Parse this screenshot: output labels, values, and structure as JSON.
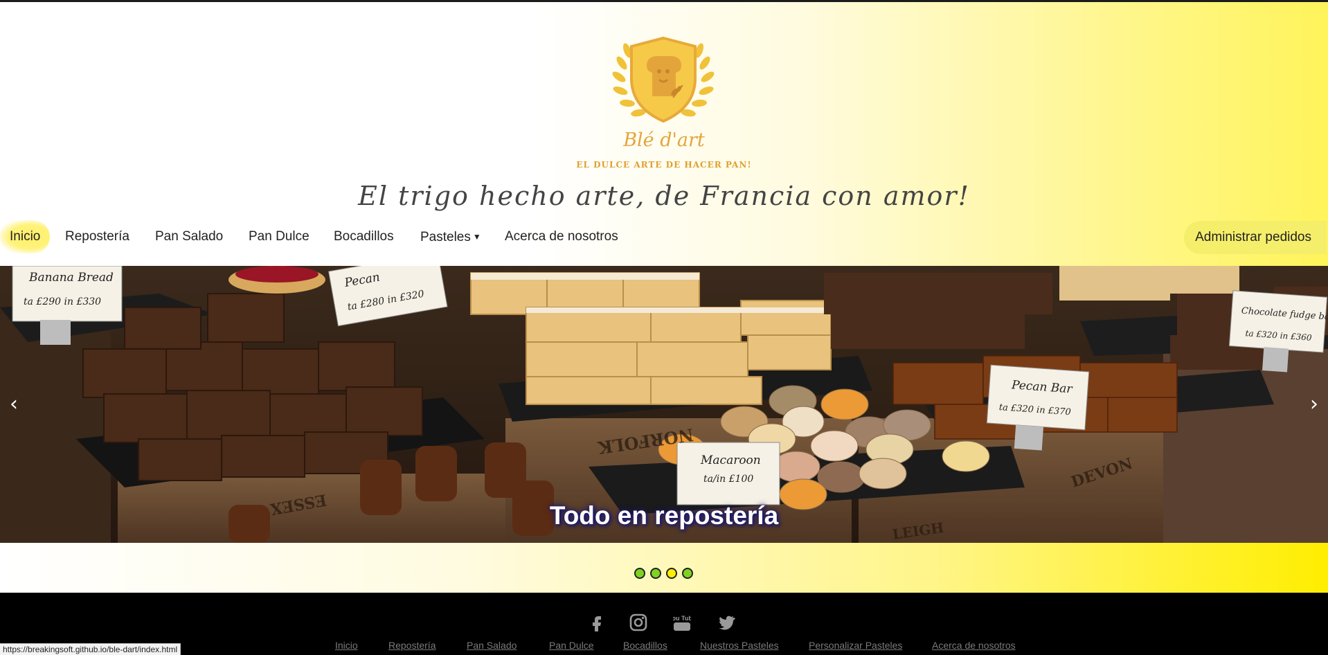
{
  "brand": {
    "name": "Blé d'art",
    "subtitle": "EL DULCE ARTE DE HACER PAN!",
    "tagline": "El trigo hecho arte, de Francia con amor!",
    "colors": {
      "gold": "#e3a53b",
      "yellow": "#fff45a",
      "shield": "#f7c948"
    }
  },
  "nav": {
    "items": [
      {
        "label": "Inicio",
        "active": true
      },
      {
        "label": "Repostería"
      },
      {
        "label": "Pan Salado"
      },
      {
        "label": "Pan Dulce"
      },
      {
        "label": "Bocadillos"
      },
      {
        "label": "Pasteles",
        "dropdown": true
      },
      {
        "label": "Acerca de nosotros"
      }
    ],
    "admin_button": "Administrar pedidos"
  },
  "carousel": {
    "caption": "Todo en repostería",
    "prev_icon": "chevron-left-icon",
    "next_icon": "chevron-right-icon",
    "prev_glyph": "‹",
    "next_glyph": "›",
    "price_tags": [
      {
        "title": "Banana Bread",
        "prices": "ta £290   in £330"
      },
      {
        "title": "Pecan",
        "prices": "ta £280   in £320"
      },
      {
        "title": "Macaroon",
        "prices": "ta/in £100"
      },
      {
        "title": "Pecan Bar",
        "prices": "ta £320   in £370"
      },
      {
        "title": "Chocolate fudge bar",
        "prices": "ta £320   in £360"
      }
    ],
    "crate_labels": [
      "NORFOLK",
      "ESSEX",
      "DEVON",
      "LEIGH"
    ],
    "indicators": [
      {
        "active": true,
        "color": "#7ed321"
      },
      {
        "active": false,
        "color": "#7ed321"
      },
      {
        "active": false,
        "color": "#ffee00"
      },
      {
        "active": false,
        "color": "#7ed321"
      }
    ]
  },
  "footer": {
    "social": [
      {
        "name": "facebook-icon"
      },
      {
        "name": "instagram-icon"
      },
      {
        "name": "youtube-icon",
        "text": "You Tube"
      },
      {
        "name": "twitter-icon"
      }
    ],
    "links": [
      "Inicio",
      "Repostería",
      "Pan Salado",
      "Pan Dulce",
      "Bocadillos",
      "Nuestros Pasteles",
      "Personalizar Pasteles",
      "Acerca de nosotros"
    ]
  },
  "status_bar": {
    "url": "https://breakingsoft.github.io/ble-dart/index.html"
  }
}
